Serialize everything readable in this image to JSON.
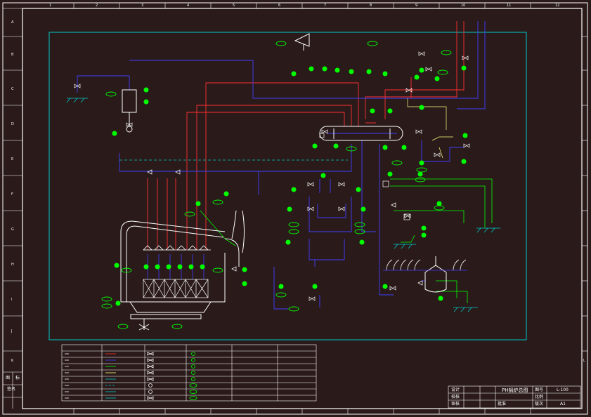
{
  "title_block": {
    "drawing_title": "PH锅炉总图",
    "drawing_no": "L-100",
    "sheet": "A1",
    "row1_label": "设计",
    "row2_label": "校核",
    "row3_label": "审核",
    "row3b_label": "批准",
    "right_label1": "图号",
    "right_label2": "比例",
    "right_label3": "版次"
  },
  "left_strip": {
    "label1": "图",
    "label2": "标",
    "label3": "签名"
  },
  "border_cols_top": [
    "1",
    "2",
    "3",
    "4",
    "5",
    "6",
    "7",
    "8",
    "9",
    "10",
    "11",
    "12"
  ],
  "border_rows_left": [
    "A",
    "B",
    "C",
    "D",
    "E",
    "F",
    "G",
    "H",
    "I",
    "J",
    "K",
    "L"
  ],
  "colors": {
    "background": "#2a1a1a",
    "frame": "#ffffff",
    "inner_frame": "#00c8c8",
    "steam": "#ff3030",
    "water": "#4040ff",
    "instrument": "#00ff00",
    "signal": "#ffff80",
    "equipment": "#ffffff"
  }
}
